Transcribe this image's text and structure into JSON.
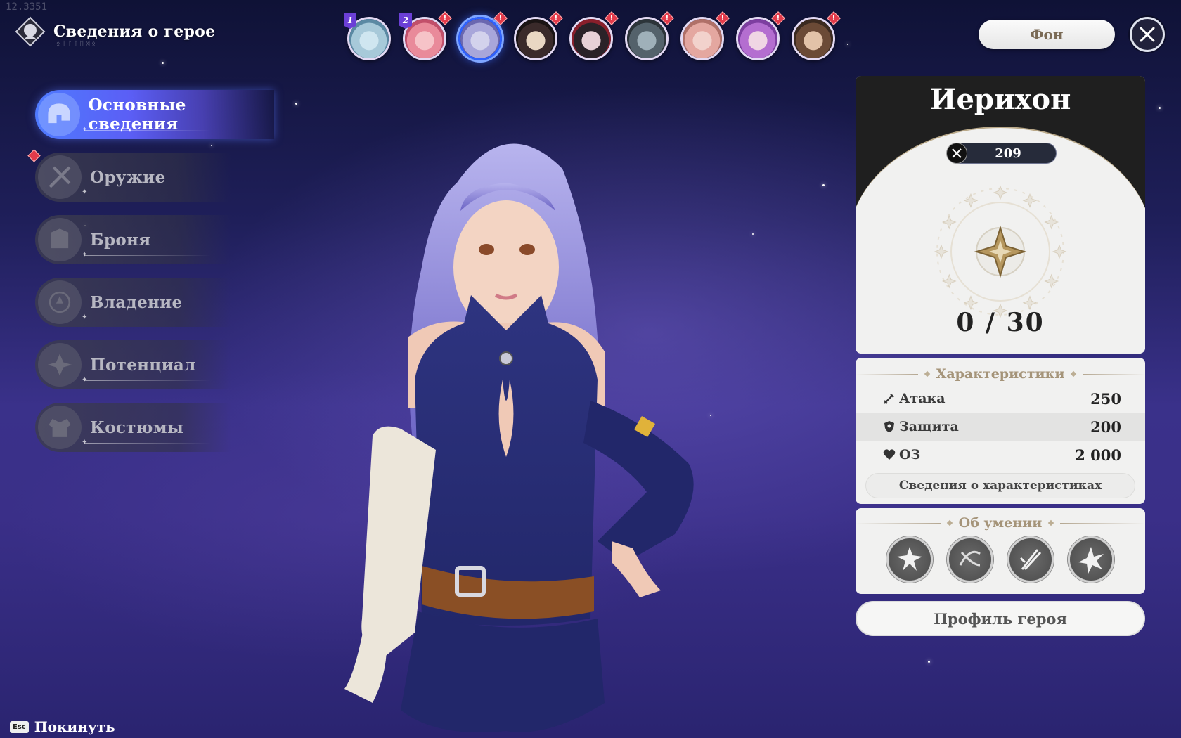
{
  "fps_counter": "12.3351",
  "header": {
    "title": "Сведения о герое",
    "subtitle": "ᛟᛁᛚᛏᛖᛞᛟ"
  },
  "portraits": [
    {
      "name": "hero-1",
      "badge": "1",
      "alert": false,
      "selected": false,
      "colors": [
        "#cfe6f0",
        "#a7c9d9",
        "#5b89a3"
      ]
    },
    {
      "name": "hero-2",
      "badge": "2",
      "alert": true,
      "selected": false,
      "colors": [
        "#f6c3c8",
        "#e98a9a",
        "#c24f6a"
      ]
    },
    {
      "name": "hero-3",
      "badge": "",
      "alert": true,
      "selected": true,
      "colors": [
        "#d3d2ec",
        "#a8a6da",
        "#6a67b0"
      ]
    },
    {
      "name": "hero-4",
      "badge": "",
      "alert": true,
      "selected": false,
      "colors": [
        "#e9d7c3",
        "#3a2a2a",
        "#1a1414"
      ]
    },
    {
      "name": "hero-5",
      "badge": "",
      "alert": true,
      "selected": false,
      "colors": [
        "#e7d0d6",
        "#2a2228",
        "#8a1f2b"
      ]
    },
    {
      "name": "hero-6",
      "badge": "",
      "alert": true,
      "selected": false,
      "colors": [
        "#9fb0b9",
        "#54626b",
        "#2c3439"
      ]
    },
    {
      "name": "hero-7",
      "badge": "",
      "alert": true,
      "selected": false,
      "colors": [
        "#f2d2cc",
        "#e4a7a0",
        "#b07068"
      ]
    },
    {
      "name": "hero-8",
      "badge": "",
      "alert": true,
      "selected": false,
      "colors": [
        "#f0d6e4",
        "#b46ed0",
        "#7d3ea0"
      ]
    },
    {
      "name": "hero-9",
      "badge": "",
      "alert": true,
      "selected": false,
      "colors": [
        "#e2c2a8",
        "#6b4a36",
        "#3b2a20"
      ]
    }
  ],
  "top_right": {
    "background_button": "Фон"
  },
  "menu": [
    {
      "label": "Основные сведения",
      "active": true,
      "alert": false,
      "icon": "helmet-icon"
    },
    {
      "label": "Оружие",
      "active": false,
      "alert": true,
      "icon": "weapon-icon"
    },
    {
      "label": "Броня",
      "active": false,
      "alert": false,
      "icon": "armor-icon"
    },
    {
      "label": "Владение",
      "active": false,
      "alert": false,
      "icon": "mastery-icon"
    },
    {
      "label": "Потенциал",
      "active": false,
      "alert": false,
      "icon": "potential-icon"
    },
    {
      "label": "Костюмы",
      "active": false,
      "alert": false,
      "icon": "costume-icon"
    }
  ],
  "hero": {
    "name": "Иерихон",
    "power": "209",
    "progress": "0 / 30",
    "progress_current": 0,
    "progress_max": 30
  },
  "stats": {
    "title": "Характеристики",
    "rows": [
      {
        "label": "Атака",
        "value": "250",
        "icon": "sword-icon"
      },
      {
        "label": "Защита",
        "value": "200",
        "icon": "shield-icon"
      },
      {
        "label": "ОЗ",
        "value": "2 000",
        "icon": "heart-icon"
      }
    ],
    "details_button": "Сведения о характеристиках"
  },
  "skills": {
    "title": "Об умении",
    "items": [
      "skill-burst-icon",
      "skill-slash-icon",
      "skill-swords-icon",
      "skill-flare-icon"
    ]
  },
  "profile_button": "Профиль героя",
  "exit": {
    "key": "Esc",
    "label": "Покинуть"
  },
  "colors": {
    "accent": "#4f7bff",
    "alert": "#e33b4b",
    "gold": "#a59479"
  }
}
